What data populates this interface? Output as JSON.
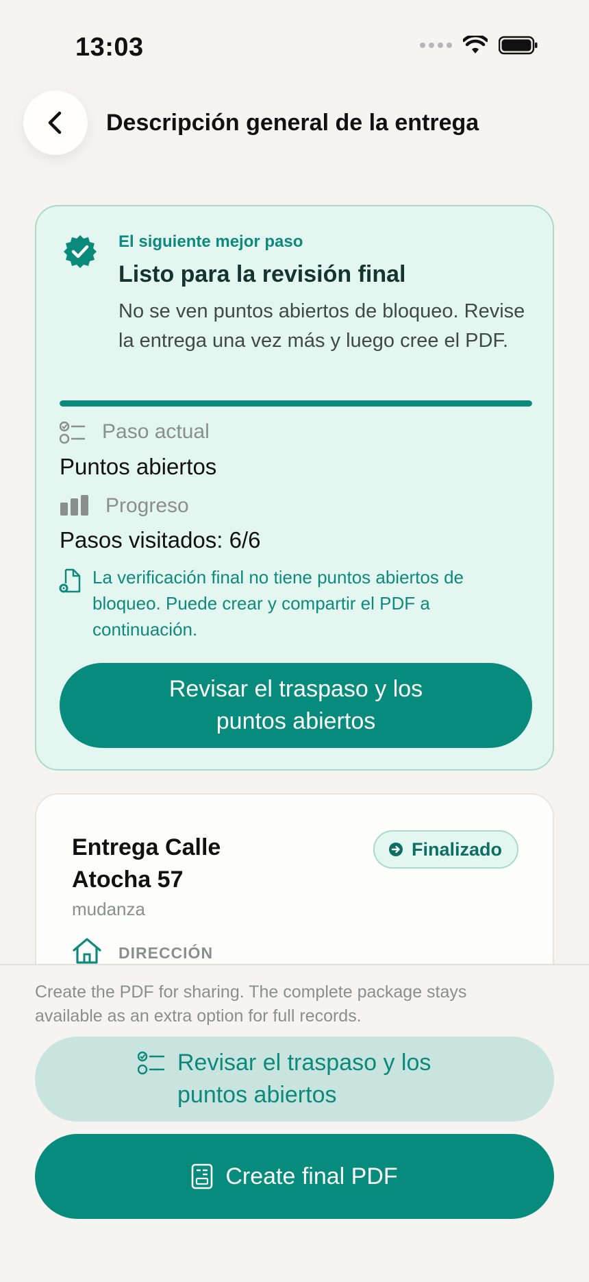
{
  "status_bar": {
    "time": "13:03"
  },
  "header": {
    "title": "Descripción general de la entrega"
  },
  "next_step": {
    "eyebrow": "El siguiente mejor paso",
    "title": "Listo para la revisión final",
    "description": "No se ven puntos abiertos de bloqueo. Revise la entrega una vez más y luego cree el PDF.",
    "progress": 1.0,
    "current_step_label": "Paso actual",
    "current_step_value": "Puntos abiertos",
    "progress_label": "Progreso",
    "progress_value": "Pasos visitados: 6/6",
    "note": "La verificación final no tiene puntos abiertos de bloqueo. Puede crear y compartir el PDF a continuación.",
    "button_label": "Revisar el traspaso y los puntos abiertos"
  },
  "summary": {
    "title": "Entrega Calle Atocha 57",
    "status": "Finalizado",
    "subtitle": "mudanza",
    "address_label": "DIRECCIÓN"
  },
  "bottom_sheet": {
    "hint": "Create the PDF for sharing. The complete package stays available as an extra option for full records.",
    "secondary_button": "Revisar el traspaso y los puntos abiertos",
    "primary_button": "Create final PDF"
  },
  "colors": {
    "accent": "#068b7c",
    "card_bg": "#e3f6ef",
    "page_bg": "#f5f4f1"
  }
}
